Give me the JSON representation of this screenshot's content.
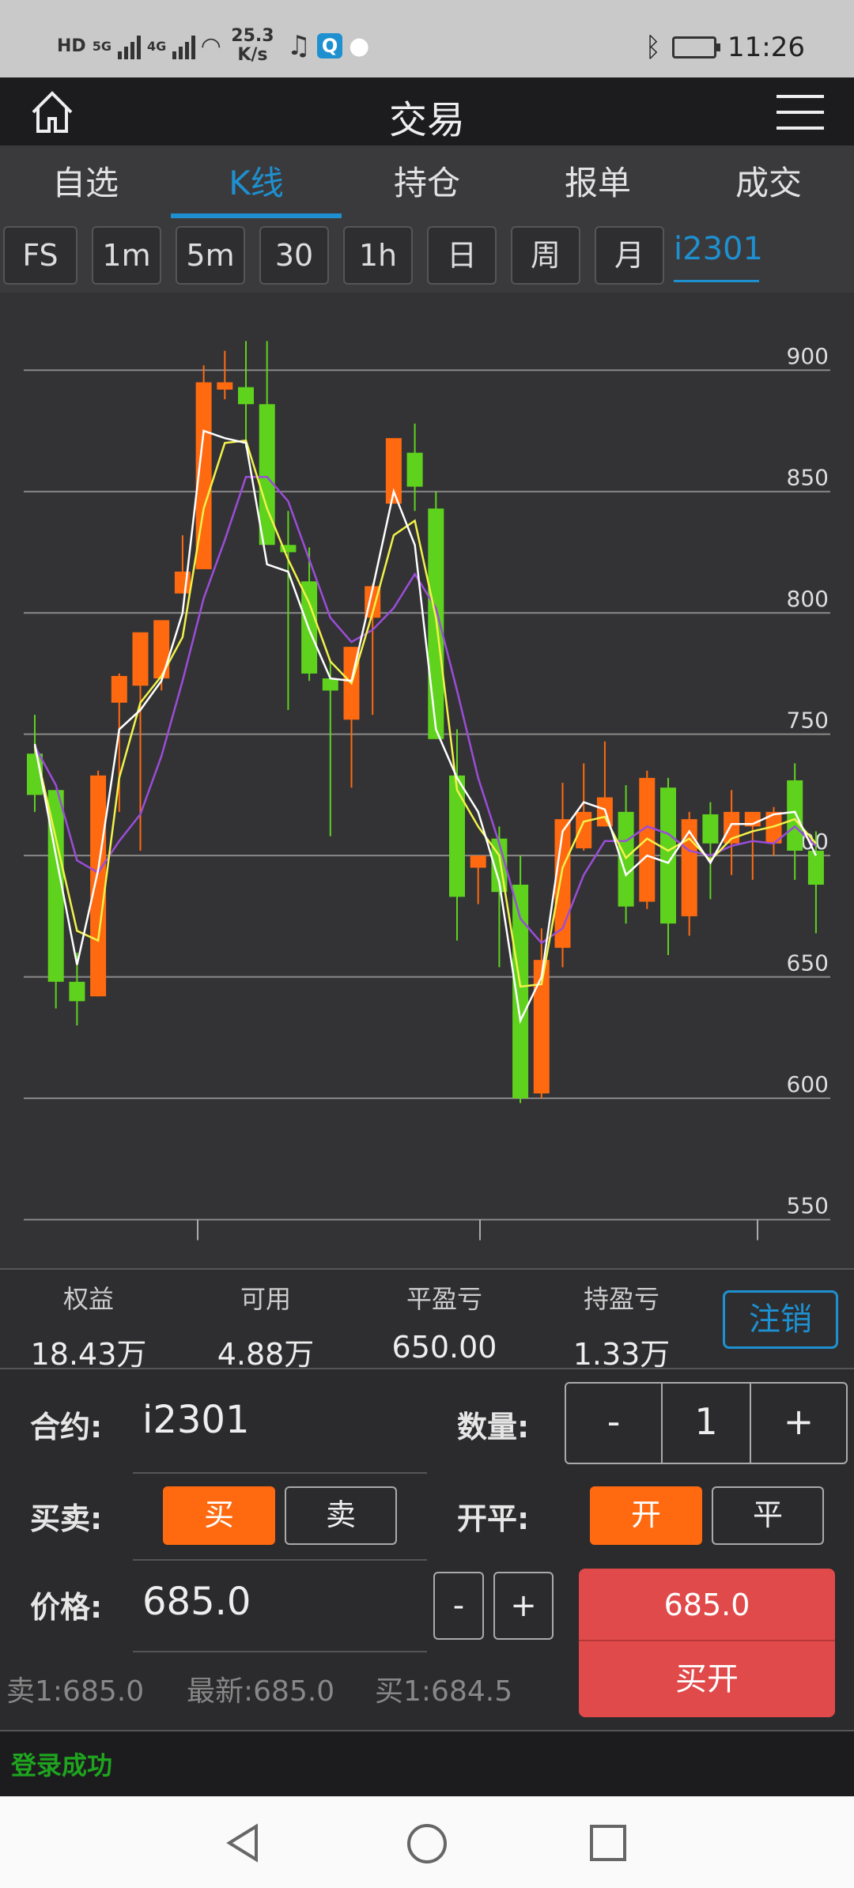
{
  "status_bar": {
    "hd1": "HD",
    "net1": "5G",
    "hd2": "HD",
    "net2": "4G",
    "speed_value": "25.3",
    "speed_unit": "K/s",
    "time": "11:26"
  },
  "app": {
    "title": "交易"
  },
  "tabs": [
    "自选",
    "K线",
    "持仓",
    "报单",
    "成交"
  ],
  "active_tab": "K线",
  "periods": [
    "FS",
    "1m",
    "5m",
    "30",
    "1h",
    "日",
    "周",
    "月"
  ],
  "symbol_tab": "i2301",
  "chart_data": {
    "type": "candlestick",
    "y_ticks": [
      "900",
      "850",
      "800",
      "750",
      "700",
      "650",
      "600",
      "550"
    ],
    "ylim": [
      530,
      932
    ],
    "up_color": "#ff6a10",
    "down_color": "#5fd21e",
    "candles": [
      {
        "o": 742,
        "h": 758,
        "l": 718,
        "c": 725
      },
      {
        "o": 727,
        "h": 727,
        "l": 637,
        "c": 648
      },
      {
        "o": 648,
        "h": 660,
        "l": 630,
        "c": 640
      },
      {
        "o": 642,
        "h": 735,
        "l": 642,
        "c": 733
      },
      {
        "o": 763,
        "h": 775,
        "l": 718,
        "c": 774
      },
      {
        "o": 770,
        "h": 778,
        "l": 702,
        "c": 792
      },
      {
        "o": 773,
        "h": 792,
        "l": 768,
        "c": 797
      },
      {
        "o": 808,
        "h": 832,
        "l": 808,
        "c": 817
      },
      {
        "o": 818,
        "h": 902,
        "l": 818,
        "c": 895
      },
      {
        "o": 892,
        "h": 908,
        "l": 888,
        "c": 895
      },
      {
        "o": 893,
        "h": 912,
        "l": 868,
        "c": 886
      },
      {
        "o": 886,
        "h": 912,
        "l": 832,
        "c": 828
      },
      {
        "o": 828,
        "h": 842,
        "l": 760,
        "c": 825
      },
      {
        "o": 813,
        "h": 827,
        "l": 772,
        "c": 775
      },
      {
        "o": 773,
        "h": 780,
        "l": 708,
        "c": 768
      },
      {
        "o": 756,
        "h": 776,
        "l": 728,
        "c": 786
      },
      {
        "o": 798,
        "h": 812,
        "l": 758,
        "c": 811
      },
      {
        "o": 845,
        "h": 870,
        "l": 845,
        "c": 872
      },
      {
        "o": 866,
        "h": 878,
        "l": 842,
        "c": 852
      },
      {
        "o": 843,
        "h": 850,
        "l": 752,
        "c": 748
      },
      {
        "o": 733,
        "h": 752,
        "l": 665,
        "c": 683
      },
      {
        "o": 695,
        "h": 700,
        "l": 680,
        "c": 700
      },
      {
        "o": 707,
        "h": 712,
        "l": 654,
        "c": 685
      },
      {
        "o": 688,
        "h": 700,
        "l": 598,
        "c": 600
      },
      {
        "o": 602,
        "h": 670,
        "l": 600,
        "c": 657
      },
      {
        "o": 662,
        "h": 730,
        "l": 654,
        "c": 715
      },
      {
        "o": 703,
        "h": 738,
        "l": 702,
        "c": 718
      },
      {
        "o": 712,
        "h": 747,
        "l": 712,
        "c": 724
      },
      {
        "o": 718,
        "h": 729,
        "l": 672,
        "c": 679
      },
      {
        "o": 681,
        "h": 735,
        "l": 678,
        "c": 732
      },
      {
        "o": 728,
        "h": 732,
        "l": 659,
        "c": 672
      },
      {
        "o": 675,
        "h": 718,
        "l": 667,
        "c": 715
      },
      {
        "o": 717,
        "h": 722,
        "l": 682,
        "c": 705
      },
      {
        "o": 705,
        "h": 727,
        "l": 692,
        "c": 718
      },
      {
        "o": 712,
        "h": 718,
        "l": 690,
        "c": 718
      },
      {
        "o": 705,
        "h": 720,
        "l": 700,
        "c": 718
      },
      {
        "o": 731,
        "h": 738,
        "l": 690,
        "c": 702
      },
      {
        "o": 702,
        "h": 710,
        "l": 668,
        "c": 688
      }
    ],
    "ma_white": [
      746,
      700,
      655,
      694,
      752,
      760,
      772,
      800,
      875,
      872,
      870,
      820,
      817,
      793,
      773,
      772,
      810,
      850,
      828,
      752,
      732,
      718,
      689,
      632,
      650,
      710,
      722,
      719,
      692,
      700,
      697,
      710,
      697,
      713,
      713,
      717,
      718,
      700
    ],
    "ma_yellow": [
      745,
      707,
      669,
      665,
      732,
      763,
      774,
      790,
      843,
      870,
      871,
      843,
      822,
      804,
      780,
      771,
      800,
      832,
      838,
      798,
      727,
      712,
      700,
      646,
      647,
      695,
      714,
      716,
      699,
      707,
      702,
      707,
      698,
      707,
      710,
      712,
      715,
      705
    ],
    "ma_purple": [
      745,
      729,
      698,
      693,
      706,
      717,
      741,
      772,
      806,
      830,
      856,
      856,
      846,
      822,
      798,
      788,
      793,
      802,
      816,
      802,
      768,
      732,
      705,
      674,
      664,
      670,
      692,
      706,
      706,
      712,
      709,
      702,
      700,
      704,
      706,
      705,
      712,
      704
    ]
  },
  "account": {
    "equity_label": "权益",
    "equity": "18.43万",
    "avail_label": "可用",
    "avail": "4.88万",
    "close_pnl_label": "平盈亏",
    "close_pnl": "650.00",
    "pos_pnl_label": "持盈亏",
    "pos_pnl": "1.33万",
    "logout": "注销"
  },
  "order": {
    "contract_label": "合约:",
    "contract": "i2301",
    "qty_label": "数量:",
    "qty_minus": "-",
    "qty": "1",
    "qty_plus": "+",
    "side_label": "买卖:",
    "buy": "买",
    "sell": "卖",
    "oc_label": "开平:",
    "open": "开",
    "close": "平",
    "price_label": "价格:",
    "price": "685.0",
    "price_minus": "-",
    "price_plus": "+",
    "submit_price": "685.0",
    "submit_action": "买开",
    "ask": "卖1:685.0",
    "last": "最新:685.0",
    "bid": "买1:684.5"
  },
  "status_message": "登录成功",
  "colors": {
    "accent": "#1e90d0",
    "up": "#ff6a10",
    "down": "#5fd21e",
    "submit": "#e04a4a",
    "success": "#1ea41e"
  }
}
